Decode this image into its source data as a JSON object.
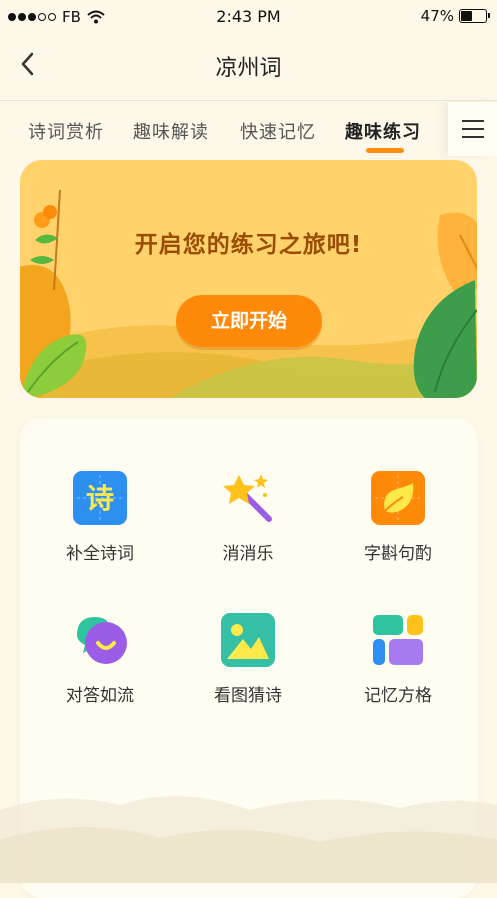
{
  "status_bar": {
    "carrier": "FB",
    "time": "2:43 PM",
    "battery": "47%",
    "battery_level": 0.47
  },
  "nav": {
    "title": "凉州词"
  },
  "tabs": [
    {
      "label": "诗词赏析",
      "active": false
    },
    {
      "label": "趣味解读",
      "active": false
    },
    {
      "label": "快速记忆",
      "active": false
    },
    {
      "label": "趣味练习",
      "active": true
    }
  ],
  "banner": {
    "heading": "开启您的练习之旅吧!",
    "button": "立即开始"
  },
  "games": [
    {
      "label": "补全诗词",
      "icon": "poem-char-icon",
      "glyph": "诗"
    },
    {
      "label": "消消乐",
      "icon": "magic-wand-icon"
    },
    {
      "label": "字斟句酌",
      "icon": "leaf-card-icon"
    },
    {
      "label": "对答如流",
      "icon": "chat-bubbles-icon"
    },
    {
      "label": "看图猜诗",
      "icon": "picture-icon"
    },
    {
      "label": "记忆方格",
      "icon": "grid-blocks-icon"
    }
  ],
  "colors": {
    "accent": "#ff8a0a",
    "background": "#fdf8e9",
    "banner": "#ffd26b"
  }
}
